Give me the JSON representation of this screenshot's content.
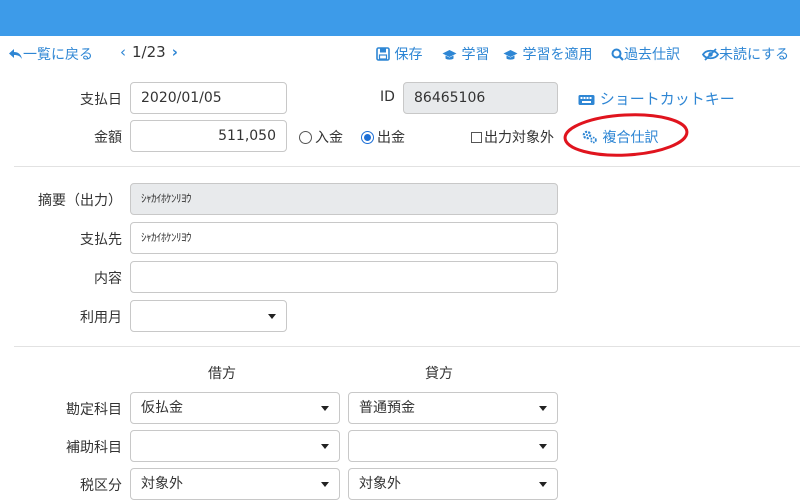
{
  "toolbar": {
    "back_label": "一覧に戻る",
    "page_indicator": "1/23",
    "save_label": "保存",
    "learn_label": "学習",
    "apply_learning_label": "学習を適用",
    "past_entries_label": "過去仕訳",
    "mark_unread_label": "未読にする"
  },
  "form": {
    "payment_date_label": "支払日",
    "payment_date_value": "2020/01/05",
    "id_label": "ID",
    "id_value": "86465106",
    "shortcut_label": "ショートカットキー",
    "amount_label": "金額",
    "amount_value": "511,050",
    "radio_income_label": "入金",
    "radio_expense_label": "出金",
    "radio_selected": "expense",
    "exclude_output_label": "出力対象外",
    "exclude_output_checked": false,
    "compound_entry_label": "複合仕訳",
    "summary_label": "摘要（出力）",
    "summary_value": "ｼｬｶｲﾎｹﾝﾘﾖｳ",
    "payee_label": "支払先",
    "payee_value": "ｼｬｶｲﾎｹﾝﾘﾖｳ",
    "content_label": "内容",
    "content_value": "",
    "usage_month_label": "利用月",
    "usage_month_value": ""
  },
  "journal": {
    "debit_header": "借方",
    "credit_header": "貸方",
    "account_label": "勘定科目",
    "debit_account": "仮払金",
    "credit_account": "普通預金",
    "sub_account_label": "補助科目",
    "debit_sub_account": "",
    "credit_sub_account": "",
    "tax_label": "税区分",
    "debit_tax": "対象外",
    "credit_tax": "対象外"
  },
  "colors": {
    "topbar": "#3d9be9",
    "link": "#2e86d4",
    "highlight_circle": "#e0141e",
    "radio_selected": "#1d6fd6"
  }
}
